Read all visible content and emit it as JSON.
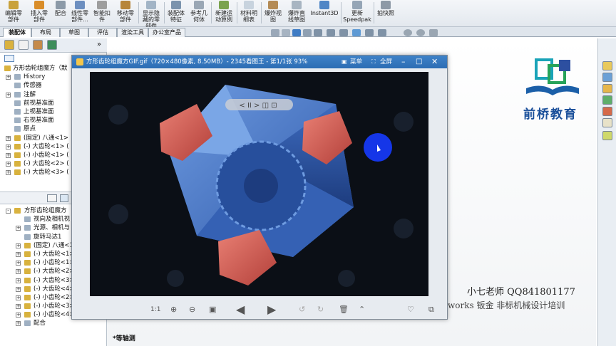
{
  "ribbon": {
    "buttons": [
      {
        "label": "编辑零\n部件",
        "icon": "edit-component-icon"
      },
      {
        "label": "插入零\n部件",
        "icon": "insert-component-icon"
      },
      {
        "label": "配合",
        "icon": "mate-icon"
      },
      {
        "label": "线性零\n部件...",
        "icon": "linear-pattern-icon"
      },
      {
        "label": "智能扣\n件",
        "icon": "smart-fastener-icon"
      },
      {
        "label": "移动零\n部件",
        "icon": "move-component-icon"
      },
      {
        "label": "显示隐\n藏的零\n部件",
        "icon": "show-hidden-icon"
      },
      {
        "label": "装配体\n特征",
        "icon": "assembly-feature-icon"
      },
      {
        "label": "参考几\n何体",
        "icon": "reference-geometry-icon"
      },
      {
        "label": "新建运\n动算例",
        "icon": "motion-study-icon"
      },
      {
        "label": "材料明\n细表",
        "icon": "bom-icon"
      },
      {
        "label": "爆炸视\n图",
        "icon": "exploded-view-icon"
      },
      {
        "label": "爆炸直\n线草图",
        "icon": "explode-line-icon"
      },
      {
        "label": "Instant3D",
        "icon": "instant3d-icon"
      },
      {
        "label": "更新\nSpeedpak",
        "icon": "speedpak-icon"
      },
      {
        "label": "拍快照",
        "icon": "snapshot-icon"
      }
    ]
  },
  "tabs": [
    "装配体",
    "布局",
    "草图",
    "评估",
    "渲染工具",
    "办公室产品"
  ],
  "feature_tree_top": {
    "root": "方形齿轮组魔方（默",
    "items": [
      {
        "label": "History",
        "expand": "+"
      },
      {
        "label": "传感器",
        "expand": ""
      },
      {
        "label": "注解",
        "expand": "+"
      },
      {
        "label": "前视基准面",
        "expand": ""
      },
      {
        "label": "上视基准面",
        "expand": ""
      },
      {
        "label": "右视基准面",
        "expand": ""
      },
      {
        "label": "原点",
        "expand": ""
      },
      {
        "label": "(固定) 八通<1>",
        "expand": "+"
      },
      {
        "label": "(-) 大齿轮<1> (",
        "expand": "+"
      },
      {
        "label": "(-) 小齿轮<1> (",
        "expand": "+"
      },
      {
        "label": "(-) 大齿轮<2> (",
        "expand": "+"
      },
      {
        "label": "(-) 大齿轮<3> (",
        "expand": "+"
      }
    ]
  },
  "feature_tree_bottom": {
    "root": "方形齿轮组魔方",
    "items": [
      {
        "label": "视向及相机视",
        "expand": ""
      },
      {
        "label": "光源、相机与",
        "expand": "+"
      },
      {
        "label": "旋转马达1",
        "expand": ""
      },
      {
        "label": "(固定) 八通<1>",
        "expand": "+"
      },
      {
        "label": "(-) 大齿轮<1>",
        "expand": "+"
      },
      {
        "label": "(-) 小齿轮<1>",
        "expand": "+"
      },
      {
        "label": "(-) 大齿轮<2>",
        "expand": "+"
      },
      {
        "label": "(-) 大齿轮<3>",
        "expand": "+"
      },
      {
        "label": "(-) 大齿轮<4>",
        "expand": "+"
      },
      {
        "label": "(-) 小齿轮<2>",
        "expand": "+"
      },
      {
        "label": "(-) 小齿轮<3>",
        "expand": "+"
      },
      {
        "label": "(-) 小齿轮<4> (默认<<默",
        "expand": "+"
      },
      {
        "label": "配合",
        "expand": "+"
      }
    ]
  },
  "viewer": {
    "title": "方形齿轮组魔方GIF.gif（720×480像素, 8.50MB）- 2345看图王 - 第1/1张 93%",
    "menu_label": "菜单",
    "fullscreen_label": "全屏",
    "zoom_ratio_label": "1:1",
    "playback_controls": "< II >"
  },
  "graphics": {
    "view_label": "*等轴测"
  },
  "logo": {
    "text": "前桥教育"
  },
  "watermark": {
    "teacher": "小七老师 QQ841801177",
    "line2": "works 钣金 非标机械设计培训"
  },
  "colors": {
    "accent_blue": "#2d6db4",
    "logo_teal": "#1aa3b8",
    "cube_blue": "#4a78c8",
    "gear_red": "#d2584e"
  }
}
